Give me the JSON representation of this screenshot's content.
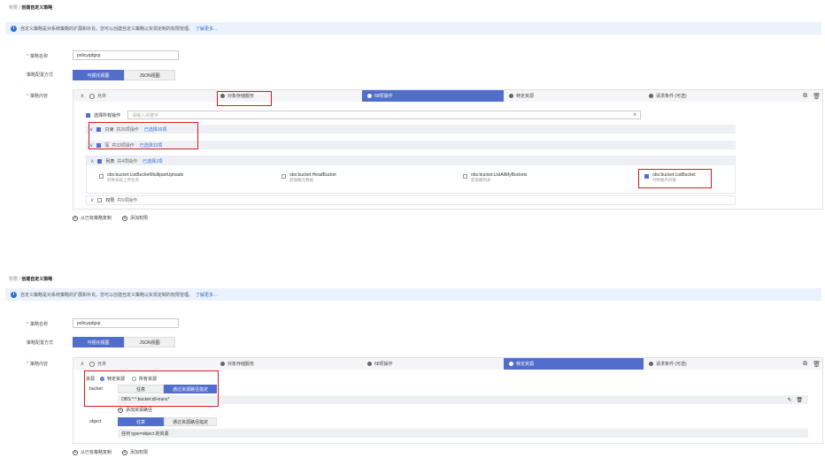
{
  "panel1": {
    "breadcrumb": {
      "parent": "权限",
      "sep": "/",
      "current": "创建自定义策略"
    },
    "notice": {
      "text": "自定义策略是对系统策略的扩展和补充，您可以创建自定义策略以实现定制的权限管理。",
      "link": "了解更多..."
    },
    "form": {
      "name_label": "策略名称",
      "name_value": "policyqdgsp",
      "mode_label": "策略配置方式",
      "mode_visual": "可视化视图",
      "mode_json": "JSON视图",
      "content_label": "策略内容"
    },
    "steps": [
      "允许",
      "对象存储服务",
      "68项操作",
      "特定资源",
      "请求条件 (可选)"
    ],
    "select_all": "选择所有操作",
    "search_placeholder": "请输入关键字",
    "groups": [
      {
        "name": "只读",
        "count": "共26项操作",
        "selected": "已选择26项"
      },
      {
        "name": "写",
        "count": "共33项操作",
        "selected": "已选择33项"
      },
      {
        "name": "列表",
        "count": "共4项操作",
        "selected": "已选择1项"
      },
      {
        "name": "权限",
        "count": "共5项操作",
        "selected": ""
      }
    ],
    "list_actions": [
      {
        "name": "obs:bucket:ListBucketMultipartUploads",
        "desc": "列举多段上传任务",
        "checked": false
      },
      {
        "name": "obs:bucket:HeadBucket",
        "desc": "获取桶元数据",
        "checked": false
      },
      {
        "name": "obs:bucket:ListAllMyBuckets",
        "desc": "获取桶列表",
        "checked": false
      },
      {
        "name": "obs:bucket:ListBucket",
        "desc": "列举桶内对象",
        "checked": true
      }
    ],
    "links": {
      "copy": "从已有策略复制",
      "add": "添加权限"
    }
  },
  "panel2": {
    "breadcrumb": {
      "parent": "权限",
      "sep": "/",
      "current": "创建自定义策略"
    },
    "notice": {
      "text": "自定义策略是对系统策略的扩展和补充，您可以创建自定义策略以实现定制的权限管理。",
      "link": "了解更多..."
    },
    "form": {
      "name_label": "策略名称",
      "name_value": "policyqdgsp",
      "mode_label": "策略配置方式",
      "mode_visual": "可视化视图",
      "mode_json": "JSON视图",
      "content_label": "策略内容"
    },
    "steps": [
      "允许",
      "对象存储服务",
      "68项操作",
      "特定资源",
      "请求条件 (可选)"
    ],
    "resource": {
      "label": "资源",
      "specific": "特定资源",
      "all": "所有资源",
      "bucket_label": "bucket",
      "any": "任意",
      "by_path": "通过资源路径指定",
      "path_value": "OBS:*:*:bucket:dli-trans*",
      "add_path": "添加资源路径",
      "object_label": "object",
      "object_any": "任意",
      "object_by_path": "通过资源路径指定",
      "object_desc": "任何 type=object 的资源"
    },
    "links": {
      "copy": "从已有策略复制",
      "add": "添加权限"
    }
  },
  "colors": {
    "primary": "#526ecc",
    "highlight_border": "#d8181c",
    "notice_bg": "#eaf2fd"
  }
}
